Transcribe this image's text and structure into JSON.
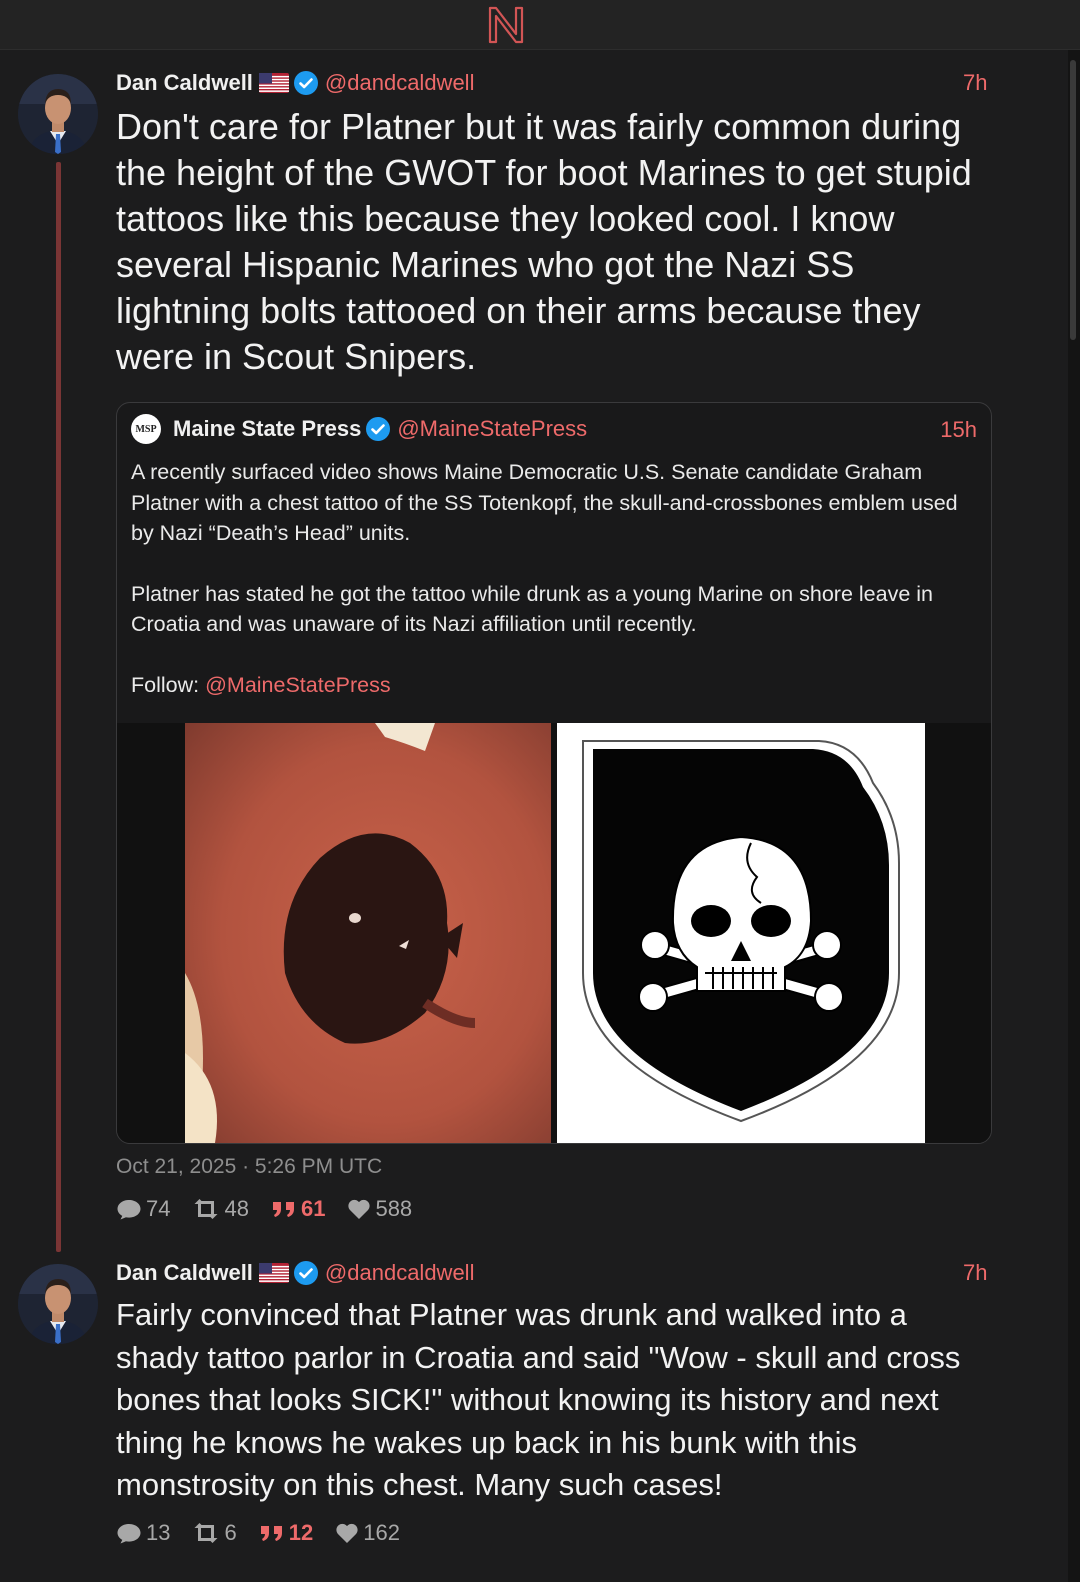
{
  "app": {
    "logo_icon": "nitter-n-logo",
    "accent_color": "#ee6a6a"
  },
  "tweets": [
    {
      "author": "Dan Caldwell",
      "flag_icon": "us-flag-icon",
      "verified_icon": "verified-badge-icon",
      "handle": "@dandcaldwell",
      "time": "7h",
      "text": "Don't care for Platner but it was fairly common during the height of the GWOT for boot Marines to get stupid tattoos like this because they looked cool. I know several Hispanic Marines who got the Nazi SS lightning bolts tattooed on their arms because they were in Scout Snipers.",
      "quote": {
        "author": "Maine State Press",
        "avatar_text": "MSP",
        "handle": "@MaineStatePress",
        "time": "15h",
        "paragraph1": "A recently surfaced video shows Maine Democratic U.S. Senate candidate Graham Platner with a chest tattoo of the SS Totenkopf, the skull-and-crossbones emblem used by Nazi “Death’s Head” units.",
        "paragraph2": "Platner has stated he got the tattoo while drunk as a young Marine on shore leave in Croatia and was unaware of its Nazi affiliation until recently.",
        "follow_label": "Follow: ",
        "follow_handle": "@MaineStatePress"
      },
      "date": "Oct 21, 2025 · 5:26 PM UTC",
      "stats": {
        "replies": "74",
        "retweets": "48",
        "quotes": "61",
        "likes": "588"
      }
    },
    {
      "author": "Dan Caldwell",
      "flag_icon": "us-flag-icon",
      "verified_icon": "verified-badge-icon",
      "handle": "@dandcaldwell",
      "time": "7h",
      "text": "Fairly convinced that Platner was drunk and walked into a shady tattoo parlor in Croatia and said \"Wow - skull and cross bones that looks SICK!\" without knowing its history and next thing he knows he wakes up back in his bunk with this monstrosity on this chest. Many such cases!",
      "stats": {
        "replies": "13",
        "retweets": "6",
        "quotes": "12",
        "likes": "162"
      }
    }
  ]
}
